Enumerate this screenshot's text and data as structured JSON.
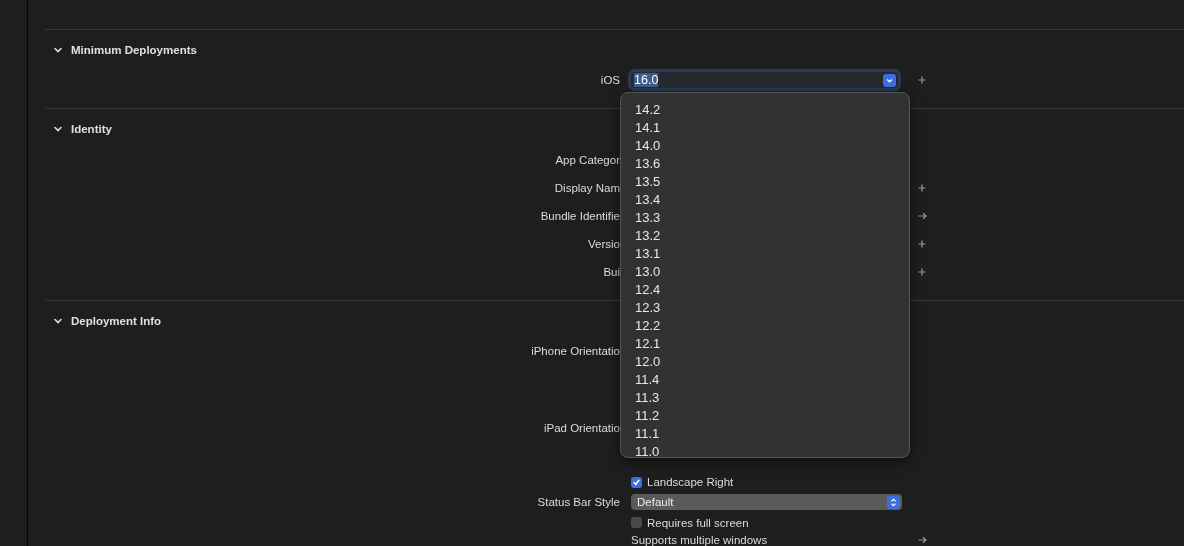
{
  "sections": [
    {
      "title": "Minimum Deployments",
      "expanded": true,
      "rows": [
        {
          "kind": "combo",
          "label": "iOS",
          "value": "16.0",
          "add_button": true
        }
      ]
    },
    {
      "title": "Identity",
      "expanded": true,
      "rows": [
        {
          "kind": "text",
          "label": "App Categor"
        },
        {
          "kind": "text",
          "label": "Display Nam",
          "add_button": true
        },
        {
          "kind": "text",
          "label": "Bundle Identifie",
          "arrow_button": true
        },
        {
          "kind": "text",
          "label": "Versio",
          "add_button": true
        },
        {
          "kind": "text",
          "label": "Bui",
          "add_button": true
        }
      ]
    },
    {
      "title": "Deployment Info",
      "expanded": true,
      "rows": [
        {
          "kind": "group",
          "label": "iPhone Orientatio",
          "options": []
        },
        {
          "kind": "group",
          "label": "iPad Orientatio",
          "options": [
            {
              "label": "Landscape Right",
              "checked": true
            }
          ]
        },
        {
          "kind": "popup",
          "label": "Status Bar Style",
          "value": "Default"
        },
        {
          "kind": "checkbox",
          "label": "Requires full screen",
          "checked": false
        },
        {
          "kind": "link",
          "label": "Supports multiple windows",
          "arrow_button": true
        }
      ]
    }
  ],
  "menu": {
    "items": [
      "14.2",
      "14.1",
      "14.0",
      "13.6",
      "13.5",
      "13.4",
      "13.3",
      "13.2",
      "13.1",
      "13.0",
      "12.4",
      "12.3",
      "12.2",
      "12.1",
      "12.0",
      "11.4",
      "11.3",
      "11.2",
      "11.1",
      "11.0"
    ]
  }
}
